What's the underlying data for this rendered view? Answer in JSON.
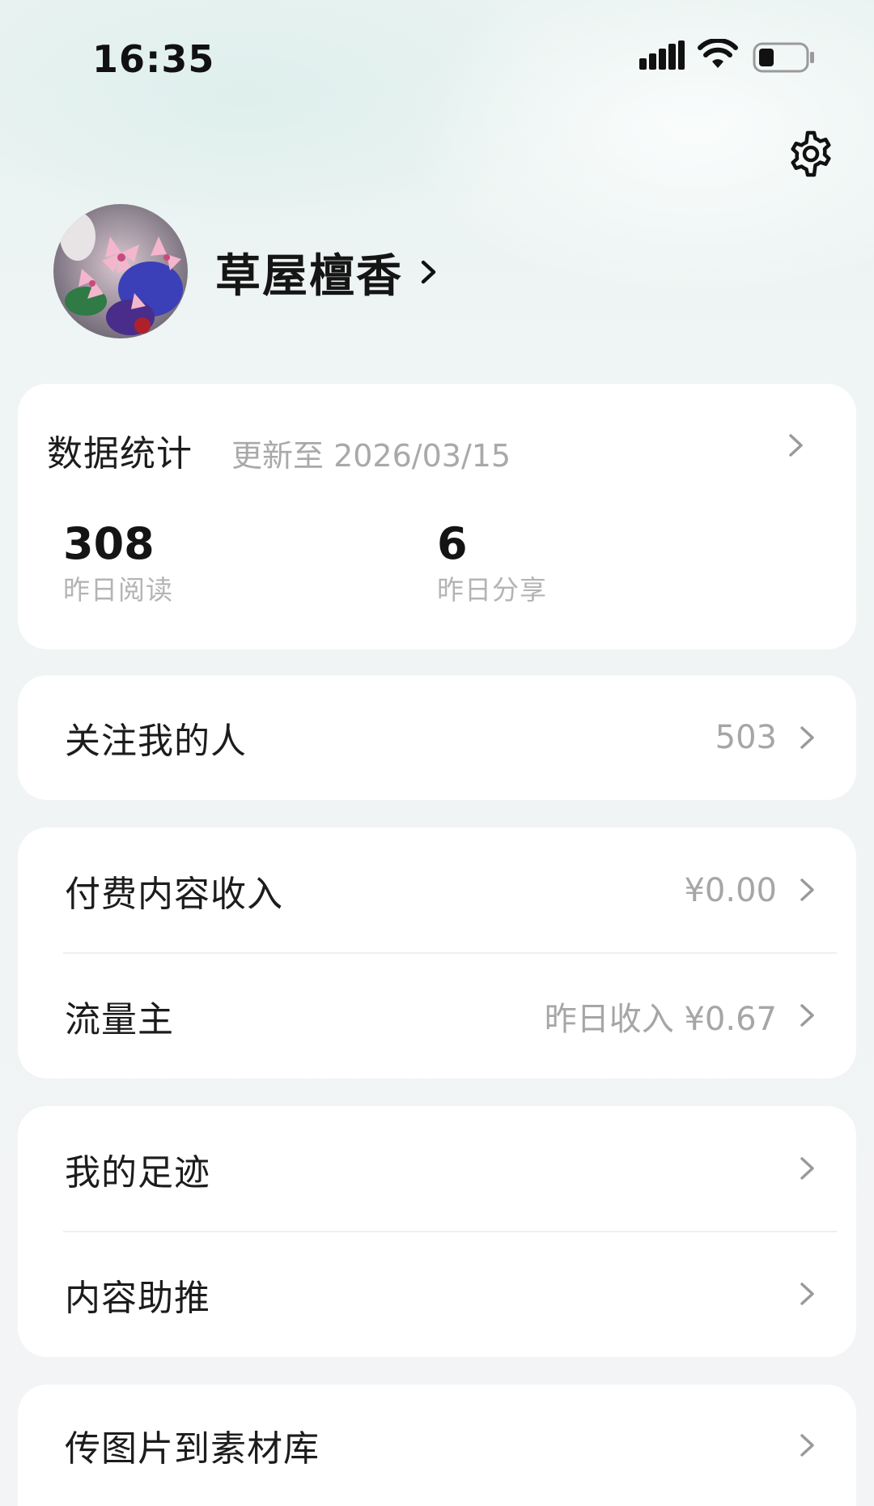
{
  "status_bar": {
    "time": "16:35",
    "icons": [
      "signal-icon",
      "wifi-icon",
      "battery-icon"
    ]
  },
  "header": {
    "settings_icon": "gear-icon"
  },
  "profile": {
    "name": "草屋檀香"
  },
  "stats_card": {
    "title": "数据统计",
    "updated": "更新至 2026/03/15",
    "stats": [
      {
        "value": "308",
        "label": "昨日阅读"
      },
      {
        "value": "6",
        "label": "昨日分享"
      }
    ]
  },
  "followers": {
    "label": "关注我的人",
    "value": "503"
  },
  "income_card": {
    "items": [
      {
        "label": "付费内容收入",
        "value": "¥0.00"
      },
      {
        "label": "流量主",
        "value": "昨日收入 ¥0.67"
      }
    ]
  },
  "tools_card": {
    "items": [
      {
        "label": "我的足迹"
      },
      {
        "label": "内容助推"
      }
    ]
  },
  "upload": {
    "label": "传图片到素材库"
  },
  "colors": {
    "background": "#eef5f4",
    "card": "#ffffff",
    "primary_text": "#1c1c1c",
    "secondary_text": "#a6a6a6"
  }
}
